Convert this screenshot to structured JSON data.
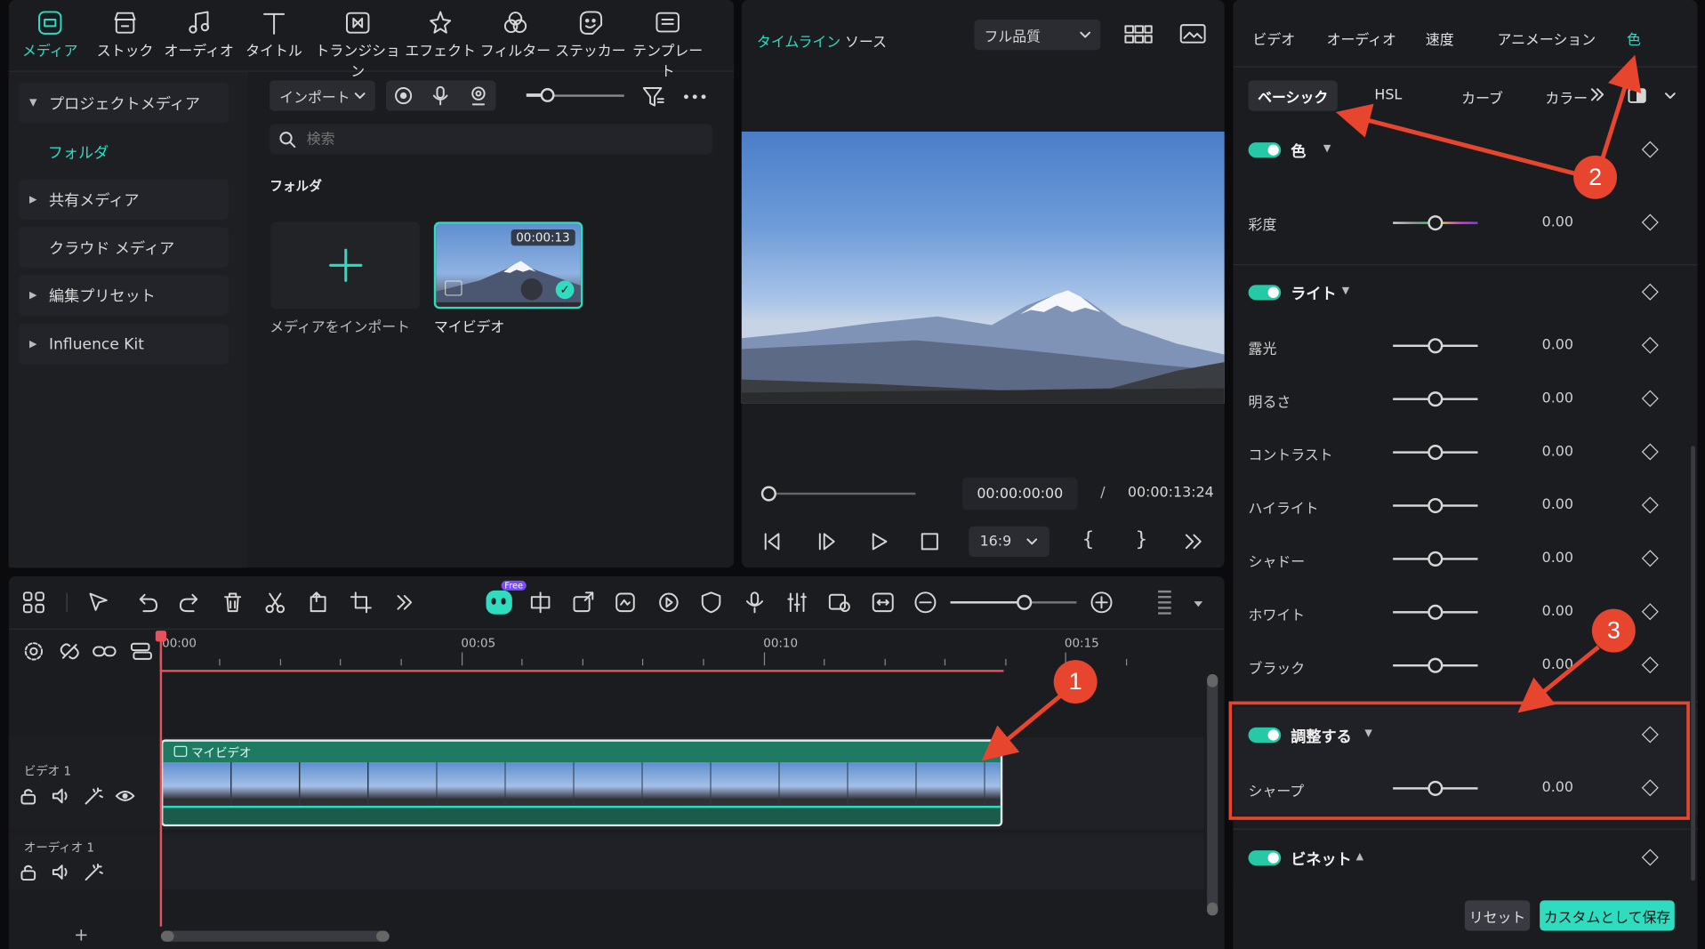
{
  "toolbar": {
    "items": [
      {
        "label": "メディア",
        "icon": "media-icon",
        "active": true
      },
      {
        "label": "ストック",
        "icon": "stock-icon"
      },
      {
        "label": "オーディオ",
        "icon": "music-note-icon"
      },
      {
        "label": "タイトル",
        "icon": "title-t-icon"
      },
      {
        "label": "トランジション",
        "icon": "transition-icon"
      },
      {
        "label": "エフェクト",
        "icon": "effect-star-icon"
      },
      {
        "label": "フィルター",
        "icon": "filter-icon"
      },
      {
        "label": "ステッカー",
        "icon": "sticker-icon"
      },
      {
        "label": "テンプレート",
        "icon": "template-icon"
      }
    ]
  },
  "sidebar": {
    "items": [
      {
        "label": "プロジェクトメディア",
        "expanded": true
      },
      {
        "label": "フォルダ",
        "active": true
      },
      {
        "label": "共有メディア"
      },
      {
        "label": "クラウド メディア"
      },
      {
        "label": "編集プリセット"
      },
      {
        "label": "Influence Kit"
      }
    ]
  },
  "media": {
    "import_label": "インポート",
    "search_placeholder": "検索",
    "folder_heading": "フォルダ",
    "import_tile_label": "メディアをインポート",
    "clip_label": "マイビデオ",
    "clip_duration": "00:00:13"
  },
  "player": {
    "tab_timeline": "タイムライン",
    "tab_source": "ソース",
    "quality": "フル品質",
    "current_time": "00:00:00:00",
    "separator": "/",
    "total_time": "00:00:13:24",
    "aspect": "16:9",
    "bracket_in": "{",
    "bracket_out": "}"
  },
  "timeline": {
    "ruler": [
      "00:00",
      "00:05",
      "00:10",
      "00:15"
    ],
    "track_video": "ビデオ 1",
    "track_audio": "オーディオ 1",
    "clip_label": "マイビデオ",
    "free_badge": "Free",
    "add_track": "+"
  },
  "right_panel": {
    "tabs": [
      "ビデオ",
      "オーディオ",
      "速度",
      "アニメーション",
      "色"
    ],
    "active_tab": "色",
    "subtabs": [
      "ベーシック",
      "HSL",
      "カーブ",
      "カラー"
    ],
    "section_color": {
      "label": "色",
      "rows": [
        {
          "label": "彩度",
          "value": "0.00"
        }
      ]
    },
    "section_light": {
      "label": "ライト",
      "rows": [
        {
          "label": "露光",
          "value": "0.00"
        },
        {
          "label": "明るさ",
          "value": "0.00"
        },
        {
          "label": "コントラスト",
          "value": "0.00"
        },
        {
          "label": "ハイライト",
          "value": "0.00"
        },
        {
          "label": "シャドー",
          "value": "0.00"
        },
        {
          "label": "ホワイト",
          "value": "0.00"
        },
        {
          "label": "ブラック",
          "value": "0.00"
        }
      ]
    },
    "section_adjust": {
      "label": "調整する",
      "rows": [
        {
          "label": "シャープ",
          "value": "0.00"
        }
      ]
    },
    "section_vignette": {
      "label": "ビネット"
    },
    "reset_label": "リセット",
    "save_label": "カスタムとして保存"
  },
  "annotations": [
    "1",
    "2",
    "3"
  ],
  "colors": {
    "accent": "#2fdcc0",
    "annotation": "#e8452f",
    "clip": "#1f7a64"
  }
}
